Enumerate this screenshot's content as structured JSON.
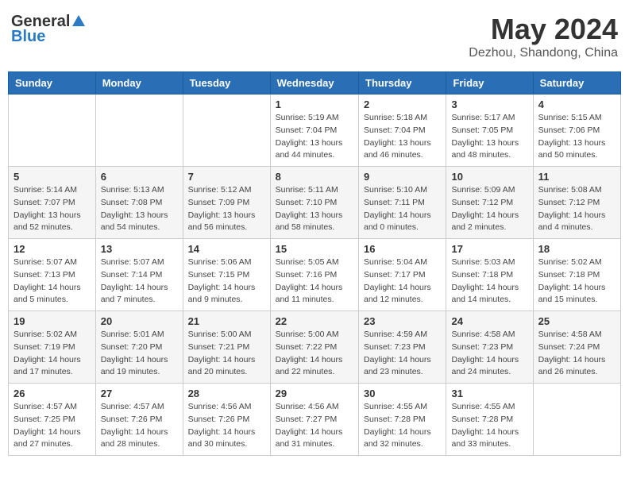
{
  "header": {
    "logo_general": "General",
    "logo_blue": "Blue",
    "month": "May 2024",
    "location": "Dezhou, Shandong, China"
  },
  "days_of_week": [
    "Sunday",
    "Monday",
    "Tuesday",
    "Wednesday",
    "Thursday",
    "Friday",
    "Saturday"
  ],
  "weeks": [
    [
      {
        "day": "",
        "info": ""
      },
      {
        "day": "",
        "info": ""
      },
      {
        "day": "",
        "info": ""
      },
      {
        "day": "1",
        "info": "Sunrise: 5:19 AM\nSunset: 7:04 PM\nDaylight: 13 hours\nand 44 minutes."
      },
      {
        "day": "2",
        "info": "Sunrise: 5:18 AM\nSunset: 7:04 PM\nDaylight: 13 hours\nand 46 minutes."
      },
      {
        "day": "3",
        "info": "Sunrise: 5:17 AM\nSunset: 7:05 PM\nDaylight: 13 hours\nand 48 minutes."
      },
      {
        "day": "4",
        "info": "Sunrise: 5:15 AM\nSunset: 7:06 PM\nDaylight: 13 hours\nand 50 minutes."
      }
    ],
    [
      {
        "day": "5",
        "info": "Sunrise: 5:14 AM\nSunset: 7:07 PM\nDaylight: 13 hours\nand 52 minutes."
      },
      {
        "day": "6",
        "info": "Sunrise: 5:13 AM\nSunset: 7:08 PM\nDaylight: 13 hours\nand 54 minutes."
      },
      {
        "day": "7",
        "info": "Sunrise: 5:12 AM\nSunset: 7:09 PM\nDaylight: 13 hours\nand 56 minutes."
      },
      {
        "day": "8",
        "info": "Sunrise: 5:11 AM\nSunset: 7:10 PM\nDaylight: 13 hours\nand 58 minutes."
      },
      {
        "day": "9",
        "info": "Sunrise: 5:10 AM\nSunset: 7:11 PM\nDaylight: 14 hours\nand 0 minutes."
      },
      {
        "day": "10",
        "info": "Sunrise: 5:09 AM\nSunset: 7:12 PM\nDaylight: 14 hours\nand 2 minutes."
      },
      {
        "day": "11",
        "info": "Sunrise: 5:08 AM\nSunset: 7:12 PM\nDaylight: 14 hours\nand 4 minutes."
      }
    ],
    [
      {
        "day": "12",
        "info": "Sunrise: 5:07 AM\nSunset: 7:13 PM\nDaylight: 14 hours\nand 5 minutes."
      },
      {
        "day": "13",
        "info": "Sunrise: 5:07 AM\nSunset: 7:14 PM\nDaylight: 14 hours\nand 7 minutes."
      },
      {
        "day": "14",
        "info": "Sunrise: 5:06 AM\nSunset: 7:15 PM\nDaylight: 14 hours\nand 9 minutes."
      },
      {
        "day": "15",
        "info": "Sunrise: 5:05 AM\nSunset: 7:16 PM\nDaylight: 14 hours\nand 11 minutes."
      },
      {
        "day": "16",
        "info": "Sunrise: 5:04 AM\nSunset: 7:17 PM\nDaylight: 14 hours\nand 12 minutes."
      },
      {
        "day": "17",
        "info": "Sunrise: 5:03 AM\nSunset: 7:18 PM\nDaylight: 14 hours\nand 14 minutes."
      },
      {
        "day": "18",
        "info": "Sunrise: 5:02 AM\nSunset: 7:18 PM\nDaylight: 14 hours\nand 15 minutes."
      }
    ],
    [
      {
        "day": "19",
        "info": "Sunrise: 5:02 AM\nSunset: 7:19 PM\nDaylight: 14 hours\nand 17 minutes."
      },
      {
        "day": "20",
        "info": "Sunrise: 5:01 AM\nSunset: 7:20 PM\nDaylight: 14 hours\nand 19 minutes."
      },
      {
        "day": "21",
        "info": "Sunrise: 5:00 AM\nSunset: 7:21 PM\nDaylight: 14 hours\nand 20 minutes."
      },
      {
        "day": "22",
        "info": "Sunrise: 5:00 AM\nSunset: 7:22 PM\nDaylight: 14 hours\nand 22 minutes."
      },
      {
        "day": "23",
        "info": "Sunrise: 4:59 AM\nSunset: 7:23 PM\nDaylight: 14 hours\nand 23 minutes."
      },
      {
        "day": "24",
        "info": "Sunrise: 4:58 AM\nSunset: 7:23 PM\nDaylight: 14 hours\nand 24 minutes."
      },
      {
        "day": "25",
        "info": "Sunrise: 4:58 AM\nSunset: 7:24 PM\nDaylight: 14 hours\nand 26 minutes."
      }
    ],
    [
      {
        "day": "26",
        "info": "Sunrise: 4:57 AM\nSunset: 7:25 PM\nDaylight: 14 hours\nand 27 minutes."
      },
      {
        "day": "27",
        "info": "Sunrise: 4:57 AM\nSunset: 7:26 PM\nDaylight: 14 hours\nand 28 minutes."
      },
      {
        "day": "28",
        "info": "Sunrise: 4:56 AM\nSunset: 7:26 PM\nDaylight: 14 hours\nand 30 minutes."
      },
      {
        "day": "29",
        "info": "Sunrise: 4:56 AM\nSunset: 7:27 PM\nDaylight: 14 hours\nand 31 minutes."
      },
      {
        "day": "30",
        "info": "Sunrise: 4:55 AM\nSunset: 7:28 PM\nDaylight: 14 hours\nand 32 minutes."
      },
      {
        "day": "31",
        "info": "Sunrise: 4:55 AM\nSunset: 7:28 PM\nDaylight: 14 hours\nand 33 minutes."
      },
      {
        "day": "",
        "info": ""
      }
    ]
  ]
}
